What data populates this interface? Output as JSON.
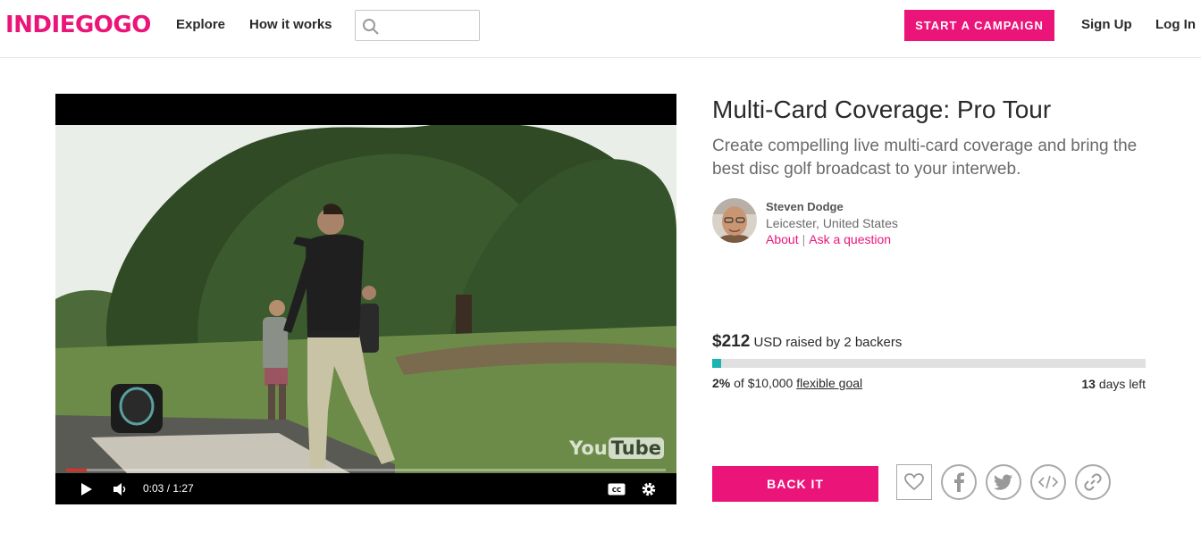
{
  "header": {
    "logo": "INDIEGOGO",
    "nav": [
      "Explore",
      "How it works"
    ],
    "search": {
      "value": "",
      "placeholder": ""
    },
    "start_campaign": "START A CAMPAIGN",
    "sign_up": "Sign Up",
    "log_in": "Log In"
  },
  "video": {
    "watermark_you": "You",
    "watermark_tube": "Tube",
    "time": "0:03 / 1:27",
    "progress_fraction": 0.035,
    "icons": [
      "play-icon",
      "volume-icon",
      "captions-icon",
      "settings-gear-icon"
    ]
  },
  "campaign": {
    "title": "Multi-Card Coverage: Pro Tour",
    "tagline": "Create compelling live multi-card coverage and bring the best disc golf broadcast to your interweb.",
    "owner": {
      "name": "Steven Dodge",
      "location": "Leicester, United States",
      "about": "About",
      "separator": "|",
      "ask": "Ask a question"
    },
    "funding": {
      "amount": "$212",
      "raised_text": "USD raised by 2 backers",
      "percent": "2%",
      "goal_text": "of $10,000",
      "goal_type": "flexible goal",
      "days_num": "13",
      "days_text": "days left",
      "progress_fraction": 0.02
    },
    "back_it": "BACK IT",
    "share_icons": [
      "heart-icon",
      "facebook-icon",
      "twitter-icon",
      "embed-icon",
      "link-icon"
    ]
  },
  "colors": {
    "brand": "#eb1478",
    "progress": "#1bb2b2",
    "video_progress": "#e52d27"
  }
}
